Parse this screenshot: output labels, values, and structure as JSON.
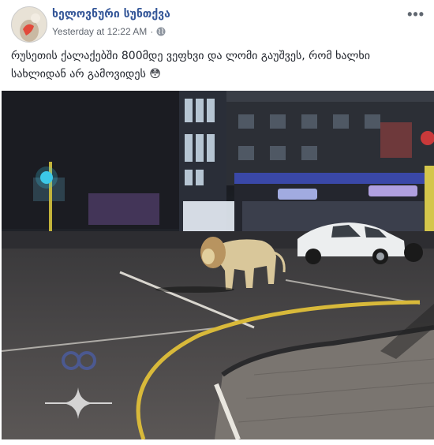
{
  "post": {
    "page_name": "ხელოვნური სუნთქვა",
    "timestamp": "Yesterday at 12:22 AM",
    "separator": "·",
    "privacy_icon": "globe-icon",
    "more_icon": "more-options-icon",
    "caption": "რუსეთის ქალაქებში 800მდე ვეფხვი და ლომი გაუშვეს, რომ ხალხი სახლიდან არ გამოვიდეს 😳"
  },
  "photo": {
    "subject": "lion-walking-street-night",
    "storefront_sign_1": "",
    "storefront_sign_2": ""
  }
}
